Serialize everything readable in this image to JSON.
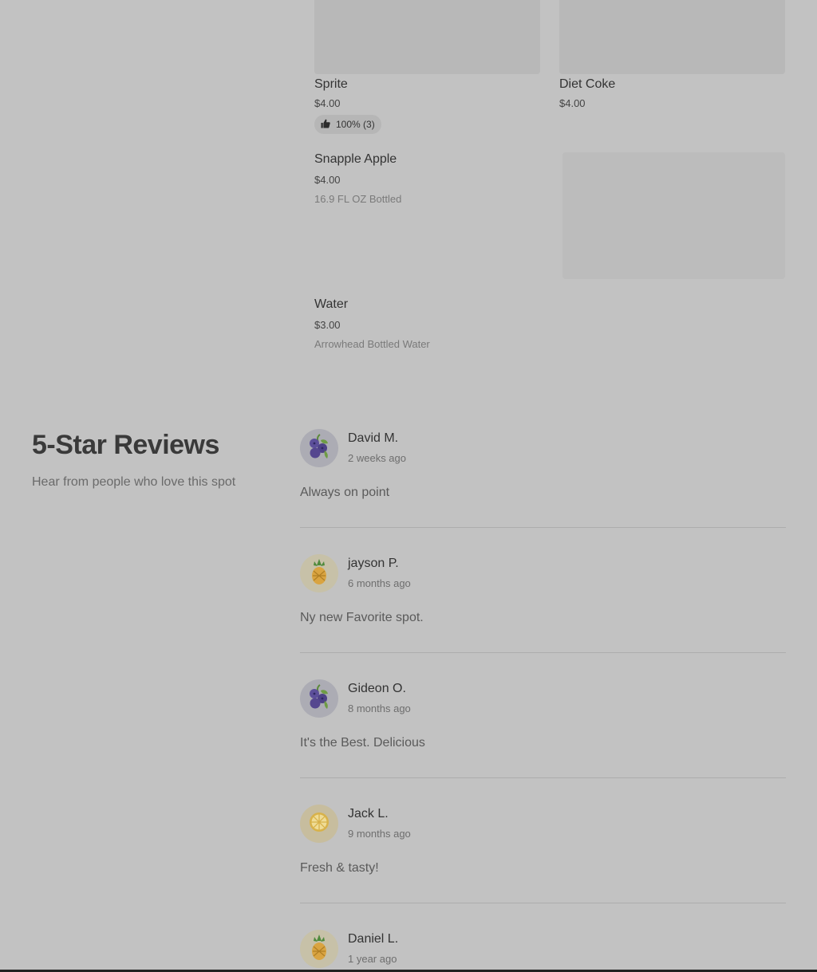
{
  "menu": {
    "items": [
      {
        "name": "Sprite",
        "price": "$4.00",
        "rating": "100% (3)"
      },
      {
        "name": "Diet Coke",
        "price": "$4.00"
      },
      {
        "name": "Snapple Apple",
        "price": "$4.00",
        "description": "16.9 FL OZ Bottled"
      },
      {
        "name": "Water",
        "price": "$3.00",
        "description": "Arrowhead Bottled Water"
      }
    ]
  },
  "reviews_section": {
    "title": "5-Star Reviews",
    "subtitle": "Hear from people who love this spot"
  },
  "reviews": [
    {
      "name": "David M.",
      "time": "2 weeks ago",
      "text": "Always on point",
      "avatar_icon": "blueberry-icon"
    },
    {
      "name": "jayson P.",
      "time": "6 months ago",
      "text": "Ny new Favorite spot.",
      "avatar_icon": "pineapple-icon"
    },
    {
      "name": "Gideon O.",
      "time": "8 months ago",
      "text": "It's the Best. Delicious",
      "avatar_icon": "blueberry-icon"
    },
    {
      "name": "Jack L.",
      "time": "9 months ago",
      "text": "Fresh & tasty!",
      "avatar_icon": "lemon-icon"
    },
    {
      "name": "Daniel L.",
      "time": "1 year ago",
      "text": "",
      "avatar_icon": "pineapple-icon"
    }
  ],
  "colors": {
    "background": "#c2c2c2",
    "blueberry_avatar_bg": "#acacb4",
    "pineapple_avatar_bg": "#c7c1a8",
    "lemon_avatar_bg": "#c7bd9e"
  }
}
